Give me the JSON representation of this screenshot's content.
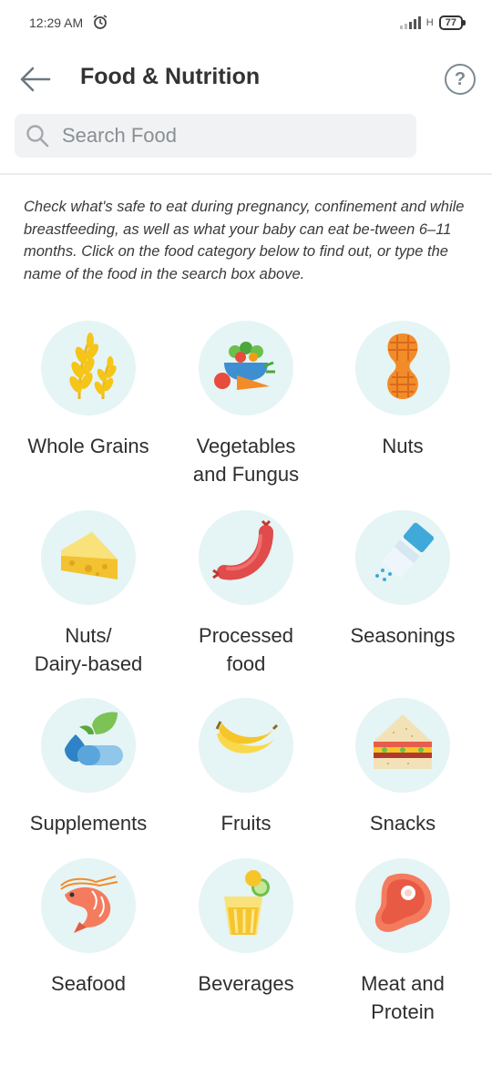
{
  "status": {
    "time": "12:29 AM",
    "battery": "77"
  },
  "header": {
    "title": "Food & Nutrition",
    "help_label": "?"
  },
  "search": {
    "placeholder": "Search Food",
    "value": ""
  },
  "intro": "Check what's safe to eat during pregnancy, confinement and while breastfeeding, as well as what your baby can eat be-tween 6–11 months. Click on the food category below to find out, or type the name of the food in the search box above.",
  "categories": [
    {
      "label": "Whole Grains",
      "icon": "wheat-icon"
    },
    {
      "label": "Vegetables\nand Fungus",
      "icon": "vegetables-icon"
    },
    {
      "label": "Nuts",
      "icon": "peanut-icon"
    },
    {
      "label": "Nuts/\nDairy-based",
      "icon": "cheese-icon"
    },
    {
      "label": "Processed\nfood",
      "icon": "sausage-icon"
    },
    {
      "label": "Seasonings",
      "icon": "salt-shaker-icon"
    },
    {
      "label": "Supplements",
      "icon": "pills-icon"
    },
    {
      "label": "Fruits",
      "icon": "banana-icon"
    },
    {
      "label": "Snacks",
      "icon": "sandwich-icon"
    },
    {
      "label": "Seafood",
      "icon": "shrimp-icon"
    },
    {
      "label": "Beverages",
      "icon": "drink-icon"
    },
    {
      "label": "Meat and\nProtein",
      "icon": "steak-icon"
    }
  ],
  "colors": {
    "circle_bg": "#e5f4f5",
    "help_icon": "#7a8a93",
    "search_bg": "#f1f2f3"
  }
}
